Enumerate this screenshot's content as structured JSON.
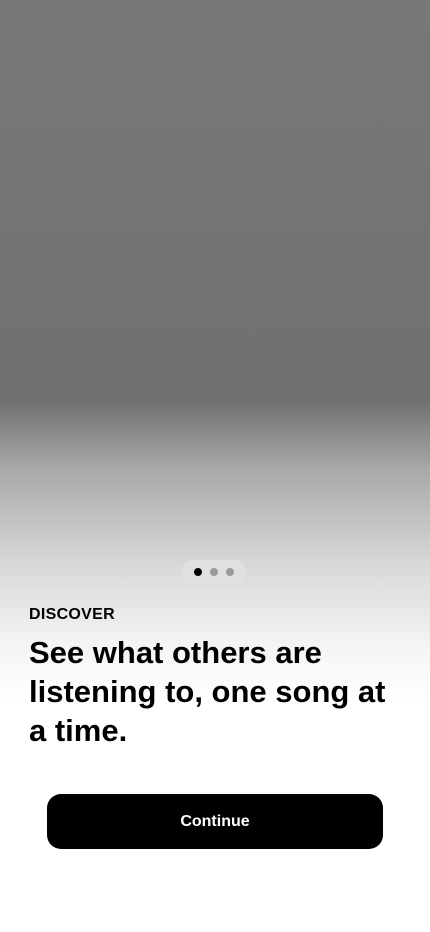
{
  "onboarding": {
    "eyebrow": "DISCOVER",
    "headline": "See what others are listening to, one song at a time.",
    "continue_label": "Continue",
    "pager": {
      "total_pages": 3,
      "current_page": 1
    }
  },
  "colors": {
    "hero_gray": "#707070",
    "background": "#ffffff",
    "button_bg": "#000000",
    "button_text": "#ffffff",
    "dot_active": "#000000",
    "dot_inactive": "#9a9a9a"
  }
}
